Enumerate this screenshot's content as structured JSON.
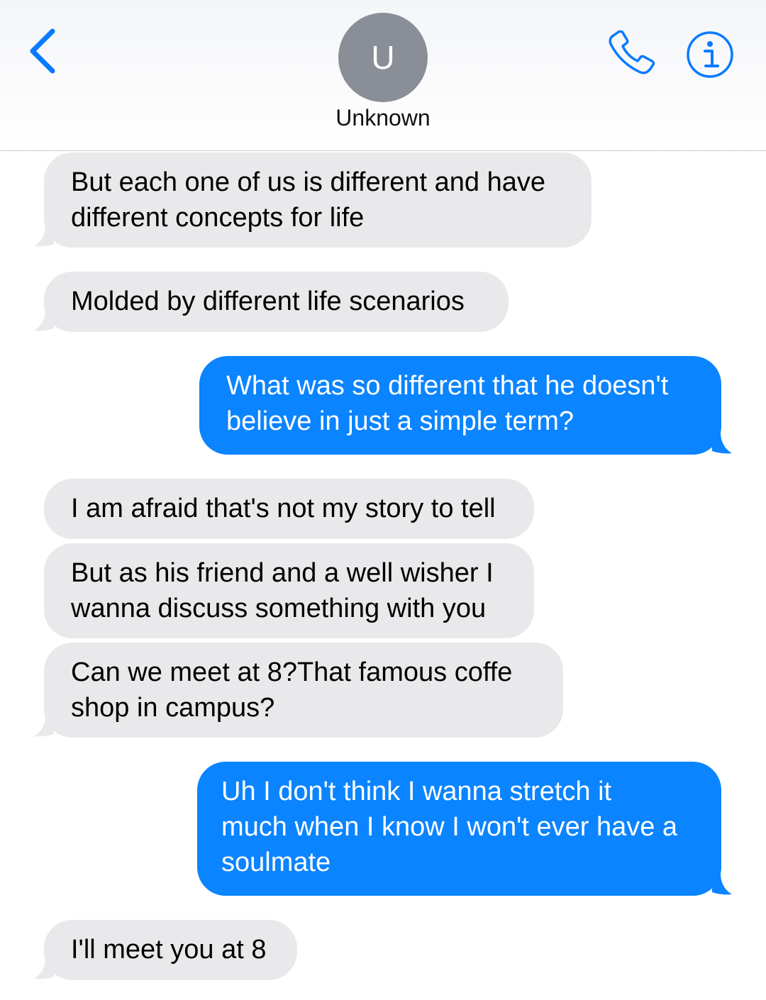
{
  "header": {
    "avatar_initial": "U",
    "contact_name": "Unknown"
  },
  "colors": {
    "incoming_bubble": "#e9e9eb",
    "outgoing_bubble": "#0b84ff",
    "accent": "#0a7aff",
    "avatar": "#8a8e97"
  },
  "icons": {
    "back": "chevron-left-icon",
    "phone": "phone-icon",
    "info": "info-icon"
  },
  "messages": [
    {
      "direction": "incoming",
      "text": "But each one of us is different and have\ndifferent concepts for life"
    },
    {
      "direction": "incoming",
      "text": "Molded by different life scenarios"
    },
    {
      "direction": "outgoing",
      "text": "What was so different that he doesn't\nbelieve in just a simple term?"
    },
    {
      "direction": "incoming",
      "text": "I am afraid that's not my story to tell"
    },
    {
      "direction": "incoming",
      "text": "But as his friend and a well wisher I\nwanna discuss something with you"
    },
    {
      "direction": "incoming",
      "text": "Can we meet at 8?That famous coffe\nshop in campus?"
    },
    {
      "direction": "outgoing",
      "text": "Uh I don't think I wanna stretch it\nmuch when I know I won't ever have a\nsoulmate"
    },
    {
      "direction": "incoming",
      "text": "I'll meet you at 8"
    }
  ]
}
